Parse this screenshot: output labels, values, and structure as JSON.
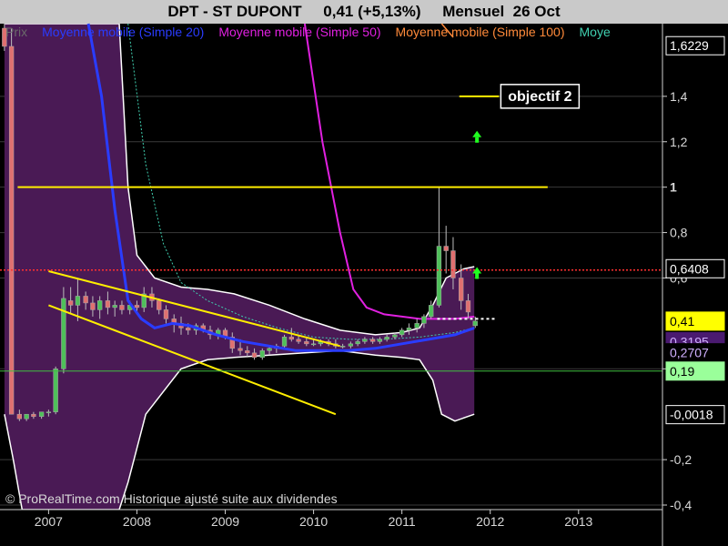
{
  "title": {
    "symbol": "DPT - ST DUPONT",
    "quote": "0,41 (+5,13%)",
    "period": "Mensuel",
    "date": "26 Oct"
  },
  "legend": [
    {
      "label": "Prix",
      "color": "#6a6a6a"
    },
    {
      "label": "Moyenne mobile (Simple 20)",
      "color": "#2a3cff"
    },
    {
      "label": "Moyenne mobile (Simple 50)",
      "color": "#e020e0"
    },
    {
      "label": "Moyenne mobile (Simple 100)",
      "color": "#ff8a3a"
    },
    {
      "label": "Moye",
      "color": "#40d0b0"
    }
  ],
  "copyright": "© ProRealTime.com Historique ajusté suite aux dividendes",
  "annotations": {
    "objective_label": "objectif 2"
  },
  "colors": {
    "bollinger_band": "#4a1a55",
    "band_edge": "#ffffff",
    "sma20": "#2a3cff",
    "sma50": "#e020e0",
    "sma100": "#ff8a3a",
    "sma_teal": "#40d0b0",
    "channel": "#ffee00",
    "candle_up": "#4fc05a",
    "candle_down": "#e07070",
    "resistance": "#ff3030",
    "support": "#40c040",
    "arrow": "#20ff20"
  },
  "chart_data": {
    "type": "candlestick",
    "x_axis": {
      "ticks": [
        "2007",
        "2008",
        "2009",
        "2010",
        "2011",
        "2012",
        "2013"
      ],
      "range": [
        2006.45,
        2013.95
      ]
    },
    "y_axis": {
      "range": [
        -0.42,
        1.72
      ],
      "ticks": [
        {
          "value": 1.4,
          "label": "1,4"
        },
        {
          "value": 1.2,
          "label": "1,2"
        },
        {
          "value": 1.0,
          "label": "1",
          "bold": true
        },
        {
          "value": 0.8,
          "label": "0,8"
        },
        {
          "value": 0.6,
          "label": "0,6"
        },
        {
          "value": 0.2,
          "label": "0,2"
        },
        {
          "value": -0.2,
          "label": "-0,2"
        },
        {
          "value": -0.4,
          "label": "-0,4"
        }
      ],
      "price_tags": [
        {
          "value": 1.6229,
          "label": "1,6229",
          "bg": "#000000",
          "fg": "#ffffff",
          "border": "#ffffff"
        },
        {
          "value": 0.6408,
          "label": "0,6408",
          "bg": "#000000",
          "fg": "#ffffff",
          "border": "#ffffff"
        },
        {
          "value": 0.41,
          "label": "0,41",
          "bg": "#ffff00",
          "fg": "#000000",
          "border": "#ffff00"
        },
        {
          "value": 0.3195,
          "label": "0,3195",
          "bg": "#4a1a70",
          "fg": "#d0b0ff",
          "border": "#4a1a70"
        },
        {
          "value": 0.2707,
          "label": "0,2707",
          "bg": "#000000",
          "fg": "#d0b0ff",
          "border": "#000000"
        },
        {
          "value": 0.19,
          "label": "0,19",
          "bg": "#9aff9a",
          "fg": "#000000",
          "border": "#9aff9a"
        },
        {
          "value": -0.0018,
          "label": "-0,0018",
          "bg": "#000000",
          "fg": "#ffffff",
          "border": "#ffffff"
        }
      ]
    },
    "candles": [
      {
        "t": 2006.5,
        "o": 1.7,
        "h": 1.72,
        "l": 1.6,
        "c": 1.62
      },
      {
        "t": 2006.58,
        "o": 1.62,
        "h": 1.7,
        "l": -0.0,
        "c": 0.0
      },
      {
        "t": 2006.67,
        "o": 0.0,
        "h": 0.02,
        "l": -0.03,
        "c": -0.02
      },
      {
        "t": 2006.75,
        "o": -0.02,
        "h": 0.0,
        "l": -0.03,
        "c": 0.0
      },
      {
        "t": 2006.83,
        "o": 0.0,
        "h": 0.01,
        "l": -0.02,
        "c": -0.01
      },
      {
        "t": 2006.92,
        "o": -0.01,
        "h": 0.01,
        "l": -0.02,
        "c": 0.01
      },
      {
        "t": 2007.0,
        "o": 0.01,
        "h": 0.02,
        "l": -0.01,
        "c": 0.01
      },
      {
        "t": 2007.08,
        "o": 0.01,
        "h": 0.21,
        "l": 0.0,
        "c": 0.2
      },
      {
        "t": 2007.17,
        "o": 0.2,
        "h": 0.56,
        "l": 0.18,
        "c": 0.51
      },
      {
        "t": 2007.25,
        "o": 0.5,
        "h": 0.56,
        "l": 0.44,
        "c": 0.48
      },
      {
        "t": 2007.33,
        "o": 0.48,
        "h": 0.6,
        "l": 0.41,
        "c": 0.52
      },
      {
        "t": 2007.42,
        "o": 0.52,
        "h": 0.54,
        "l": 0.46,
        "c": 0.49
      },
      {
        "t": 2007.5,
        "o": 0.49,
        "h": 0.52,
        "l": 0.43,
        "c": 0.46
      },
      {
        "t": 2007.58,
        "o": 0.46,
        "h": 0.52,
        "l": 0.42,
        "c": 0.5
      },
      {
        "t": 2007.67,
        "o": 0.5,
        "h": 0.54,
        "l": 0.44,
        "c": 0.47
      },
      {
        "t": 2007.75,
        "o": 0.47,
        "h": 0.5,
        "l": 0.43,
        "c": 0.48
      },
      {
        "t": 2007.83,
        "o": 0.48,
        "h": 0.5,
        "l": 0.44,
        "c": 0.46
      },
      {
        "t": 2007.92,
        "o": 0.46,
        "h": 0.5,
        "l": 0.44,
        "c": 0.48
      },
      {
        "t": 2008.0,
        "o": 0.48,
        "h": 0.5,
        "l": 0.45,
        "c": 0.47
      },
      {
        "t": 2008.08,
        "o": 0.47,
        "h": 0.56,
        "l": 0.45,
        "c": 0.53
      },
      {
        "t": 2008.17,
        "o": 0.53,
        "h": 0.56,
        "l": 0.47,
        "c": 0.5
      },
      {
        "t": 2008.25,
        "o": 0.5,
        "h": 0.51,
        "l": 0.44,
        "c": 0.46
      },
      {
        "t": 2008.33,
        "o": 0.46,
        "h": 0.48,
        "l": 0.4,
        "c": 0.42
      },
      {
        "t": 2008.42,
        "o": 0.42,
        "h": 0.44,
        "l": 0.36,
        "c": 0.4
      },
      {
        "t": 2008.5,
        "o": 0.4,
        "h": 0.43,
        "l": 0.35,
        "c": 0.38
      },
      {
        "t": 2008.58,
        "o": 0.38,
        "h": 0.4,
        "l": 0.35,
        "c": 0.37
      },
      {
        "t": 2008.67,
        "o": 0.37,
        "h": 0.4,
        "l": 0.35,
        "c": 0.39
      },
      {
        "t": 2008.75,
        "o": 0.39,
        "h": 0.4,
        "l": 0.36,
        "c": 0.37
      },
      {
        "t": 2008.83,
        "o": 0.37,
        "h": 0.39,
        "l": 0.33,
        "c": 0.35
      },
      {
        "t": 2008.92,
        "o": 0.35,
        "h": 0.38,
        "l": 0.33,
        "c": 0.37
      },
      {
        "t": 2009.0,
        "o": 0.37,
        "h": 0.38,
        "l": 0.33,
        "c": 0.34
      },
      {
        "t": 2009.08,
        "o": 0.34,
        "h": 0.36,
        "l": 0.27,
        "c": 0.29
      },
      {
        "t": 2009.17,
        "o": 0.29,
        "h": 0.33,
        "l": 0.26,
        "c": 0.28
      },
      {
        "t": 2009.25,
        "o": 0.28,
        "h": 0.3,
        "l": 0.25,
        "c": 0.27
      },
      {
        "t": 2009.33,
        "o": 0.27,
        "h": 0.29,
        "l": 0.24,
        "c": 0.25
      },
      {
        "t": 2009.42,
        "o": 0.25,
        "h": 0.29,
        "l": 0.24,
        "c": 0.28
      },
      {
        "t": 2009.5,
        "o": 0.28,
        "h": 0.3,
        "l": 0.26,
        "c": 0.29
      },
      {
        "t": 2009.58,
        "o": 0.29,
        "h": 0.31,
        "l": 0.27,
        "c": 0.3
      },
      {
        "t": 2009.67,
        "o": 0.3,
        "h": 0.35,
        "l": 0.29,
        "c": 0.34
      },
      {
        "t": 2009.75,
        "o": 0.34,
        "h": 0.38,
        "l": 0.32,
        "c": 0.33
      },
      {
        "t": 2009.83,
        "o": 0.33,
        "h": 0.35,
        "l": 0.31,
        "c": 0.32
      },
      {
        "t": 2009.92,
        "o": 0.32,
        "h": 0.34,
        "l": 0.3,
        "c": 0.31
      },
      {
        "t": 2010.0,
        "o": 0.31,
        "h": 0.33,
        "l": 0.3,
        "c": 0.31
      },
      {
        "t": 2010.08,
        "o": 0.31,
        "h": 0.33,
        "l": 0.3,
        "c": 0.32
      },
      {
        "t": 2010.17,
        "o": 0.32,
        "h": 0.33,
        "l": 0.3,
        "c": 0.31
      },
      {
        "t": 2010.25,
        "o": 0.31,
        "h": 0.33,
        "l": 0.29,
        "c": 0.3
      },
      {
        "t": 2010.33,
        "o": 0.3,
        "h": 0.31,
        "l": 0.29,
        "c": 0.3
      },
      {
        "t": 2010.42,
        "o": 0.3,
        "h": 0.32,
        "l": 0.29,
        "c": 0.31
      },
      {
        "t": 2010.5,
        "o": 0.31,
        "h": 0.33,
        "l": 0.3,
        "c": 0.32
      },
      {
        "t": 2010.58,
        "o": 0.32,
        "h": 0.34,
        "l": 0.31,
        "c": 0.33
      },
      {
        "t": 2010.67,
        "o": 0.33,
        "h": 0.34,
        "l": 0.31,
        "c": 0.32
      },
      {
        "t": 2010.75,
        "o": 0.32,
        "h": 0.34,
        "l": 0.31,
        "c": 0.33
      },
      {
        "t": 2010.83,
        "o": 0.33,
        "h": 0.35,
        "l": 0.32,
        "c": 0.34
      },
      {
        "t": 2010.92,
        "o": 0.34,
        "h": 0.36,
        "l": 0.33,
        "c": 0.35
      },
      {
        "t": 2011.0,
        "o": 0.35,
        "h": 0.38,
        "l": 0.34,
        "c": 0.37
      },
      {
        "t": 2011.08,
        "o": 0.37,
        "h": 0.4,
        "l": 0.35,
        "c": 0.38
      },
      {
        "t": 2011.17,
        "o": 0.38,
        "h": 0.42,
        "l": 0.36,
        "c": 0.4
      },
      {
        "t": 2011.25,
        "o": 0.4,
        "h": 0.44,
        "l": 0.38,
        "c": 0.43
      },
      {
        "t": 2011.33,
        "o": 0.43,
        "h": 0.5,
        "l": 0.42,
        "c": 0.48
      },
      {
        "t": 2011.42,
        "o": 0.48,
        "h": 1.0,
        "l": 0.47,
        "c": 0.74
      },
      {
        "t": 2011.5,
        "o": 0.74,
        "h": 0.83,
        "l": 0.62,
        "c": 0.72
      },
      {
        "t": 2011.58,
        "o": 0.72,
        "h": 0.78,
        "l": 0.55,
        "c": 0.6
      },
      {
        "t": 2011.67,
        "o": 0.6,
        "h": 0.66,
        "l": 0.46,
        "c": 0.5
      },
      {
        "t": 2011.75,
        "o": 0.5,
        "h": 0.53,
        "l": 0.42,
        "c": 0.45
      },
      {
        "t": 2011.83,
        "o": 0.39,
        "h": 0.43,
        "l": 0.38,
        "c": 0.41
      }
    ],
    "bollinger_upper": [
      [
        2006.5,
        1.75
      ],
      [
        2006.6,
        1.75
      ],
      [
        2006.8,
        1.75
      ],
      [
        2007.2,
        1.75
      ],
      [
        2007.6,
        1.75
      ],
      [
        2007.8,
        1.75
      ],
      [
        2007.9,
        1.0
      ],
      [
        2008.0,
        0.7
      ],
      [
        2008.2,
        0.6
      ],
      [
        2008.5,
        0.56
      ],
      [
        2008.8,
        0.55
      ],
      [
        2009.1,
        0.53
      ],
      [
        2009.5,
        0.48
      ],
      [
        2009.9,
        0.42
      ],
      [
        2010.3,
        0.37
      ],
      [
        2010.7,
        0.35
      ],
      [
        2011.0,
        0.36
      ],
      [
        2011.2,
        0.38
      ],
      [
        2011.35,
        0.48
      ],
      [
        2011.5,
        0.6
      ],
      [
        2011.7,
        0.64
      ],
      [
        2011.82,
        0.65
      ]
    ],
    "bollinger_lower": [
      [
        2006.5,
        0.0
      ],
      [
        2006.6,
        -0.2
      ],
      [
        2006.7,
        -0.42
      ],
      [
        2007.8,
        -0.42
      ],
      [
        2007.9,
        -0.3
      ],
      [
        2008.1,
        0.0
      ],
      [
        2008.3,
        0.1
      ],
      [
        2008.5,
        0.2
      ],
      [
        2008.8,
        0.24
      ],
      [
        2009.1,
        0.25
      ],
      [
        2009.5,
        0.26
      ],
      [
        2009.9,
        0.27
      ],
      [
        2010.3,
        0.28
      ],
      [
        2010.7,
        0.26
      ],
      [
        2011.0,
        0.25
      ],
      [
        2011.2,
        0.24
      ],
      [
        2011.35,
        0.15
      ],
      [
        2011.45,
        0.0
      ],
      [
        2011.6,
        -0.03
      ],
      [
        2011.82,
        0.0
      ]
    ],
    "sma20": [
      [
        2007.45,
        1.72
      ],
      [
        2007.6,
        1.4
      ],
      [
        2007.75,
        0.9
      ],
      [
        2007.9,
        0.5
      ],
      [
        2008.05,
        0.42
      ],
      [
        2008.2,
        0.38
      ],
      [
        2008.4,
        0.4
      ],
      [
        2008.6,
        0.39
      ],
      [
        2008.9,
        0.35
      ],
      [
        2009.2,
        0.32
      ],
      [
        2009.5,
        0.3
      ],
      [
        2009.8,
        0.28
      ],
      [
        2010.1,
        0.28
      ],
      [
        2010.4,
        0.28
      ],
      [
        2010.7,
        0.29
      ],
      [
        2011.0,
        0.31
      ],
      [
        2011.3,
        0.33
      ],
      [
        2011.6,
        0.35
      ],
      [
        2011.82,
        0.38
      ]
    ],
    "sma50": [
      [
        2009.9,
        1.72
      ],
      [
        2010.1,
        1.2
      ],
      [
        2010.3,
        0.8
      ],
      [
        2010.45,
        0.55
      ],
      [
        2010.6,
        0.47
      ],
      [
        2010.8,
        0.44
      ],
      [
        2011.0,
        0.43
      ],
      [
        2011.2,
        0.42
      ],
      [
        2011.4,
        0.42
      ],
      [
        2011.6,
        0.42
      ],
      [
        2011.82,
        0.43
      ]
    ],
    "sma100": [
      [
        2011.45,
        1.72
      ],
      [
        2011.58,
        1.66
      ]
    ],
    "sma_teal": [
      [
        2007.9,
        1.72
      ],
      [
        2008.1,
        1.1
      ],
      [
        2008.3,
        0.75
      ],
      [
        2008.5,
        0.58
      ],
      [
        2008.8,
        0.5
      ],
      [
        2009.2,
        0.43
      ],
      [
        2009.6,
        0.38
      ],
      [
        2010.0,
        0.34
      ],
      [
        2010.4,
        0.33
      ],
      [
        2010.8,
        0.33
      ],
      [
        2011.2,
        0.34
      ],
      [
        2011.6,
        0.36
      ],
      [
        2011.82,
        0.38
      ]
    ],
    "lines": [
      {
        "name": "resistance-1",
        "from": [
          2006.65,
          1.0
        ],
        "to": [
          2012.65,
          1.0
        ]
      },
      {
        "name": "channel-upper",
        "from": [
          2007.0,
          0.63
        ],
        "to": [
          2010.3,
          0.3
        ]
      },
      {
        "name": "channel-lower",
        "from": [
          2007.0,
          0.48
        ],
        "to": [
          2010.25,
          0.0
        ]
      },
      {
        "name": "objective-2",
        "from": [
          2011.65,
          1.4
        ],
        "to": [
          2012.1,
          1.4
        ]
      }
    ],
    "levels": [
      {
        "name": "resistance-red",
        "value": 0.635,
        "style": "dotted"
      },
      {
        "name": "support-green",
        "value": 0.19,
        "style": "solid"
      },
      {
        "name": "current-white",
        "value": 0.42,
        "from": 2011.4,
        "to": 2012.05,
        "style": "dashed"
      }
    ],
    "arrows": [
      {
        "t": 2011.85,
        "y": 1.22
      },
      {
        "t": 2011.85,
        "y": 0.62
      }
    ]
  }
}
